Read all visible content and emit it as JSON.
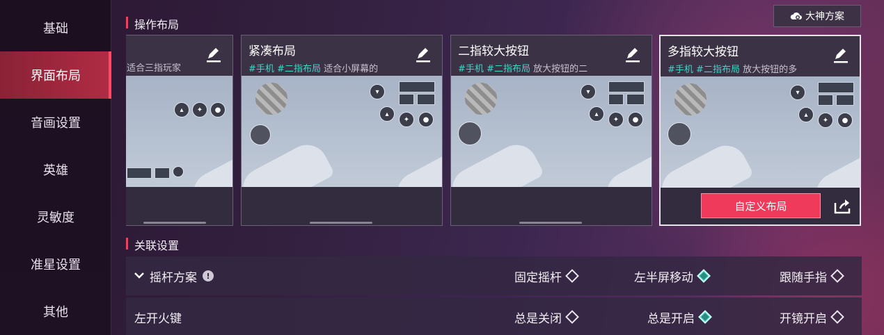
{
  "sidebar": {
    "items": [
      {
        "label": "基础",
        "active": false
      },
      {
        "label": "界面布局",
        "active": true
      },
      {
        "label": "音画设置",
        "active": false
      },
      {
        "label": "英雄",
        "active": false
      },
      {
        "label": "灵敏度",
        "active": false
      },
      {
        "label": "准星设置",
        "active": false
      },
      {
        "label": "其他",
        "active": false
      }
    ]
  },
  "layout_section": {
    "title": "操作布局",
    "god_scheme_label": "大神方案",
    "cards": [
      {
        "name": "",
        "tags_plain": "适合三指玩家",
        "selected": false
      },
      {
        "name": "紧凑布局",
        "tag1": "#手机",
        "tag2": "#二指布局",
        "desc": "适合小屏幕的",
        "selected": false
      },
      {
        "name": "二指较大按钮",
        "tag1": "#手机",
        "tag2": "#二指布局",
        "desc": "放大按钮的二",
        "selected": false
      },
      {
        "name": "多指较大按钮",
        "tag1": "#手机",
        "tag2": "#二指布局",
        "desc": "放大按钮的多",
        "selected": true
      }
    ],
    "custom_layout_label": "自定义布局"
  },
  "linked_section": {
    "title": "关联设置",
    "rows": [
      {
        "label": "摇杆方案",
        "options": [
          {
            "label": "固定摇杆",
            "checked": false
          },
          {
            "label": "左半屏移动",
            "checked": true
          },
          {
            "label": "跟随手指",
            "checked": false
          }
        ]
      },
      {
        "label": "左开火键",
        "options": [
          {
            "label": "总是关闭",
            "checked": false
          },
          {
            "label": "总是开启",
            "checked": true
          },
          {
            "label": "开镜开启",
            "checked": false
          }
        ]
      }
    ]
  },
  "colors": {
    "accent": "#f03a5c",
    "tag": "#41d6c8",
    "selected_diamond": "#45d2c2"
  }
}
